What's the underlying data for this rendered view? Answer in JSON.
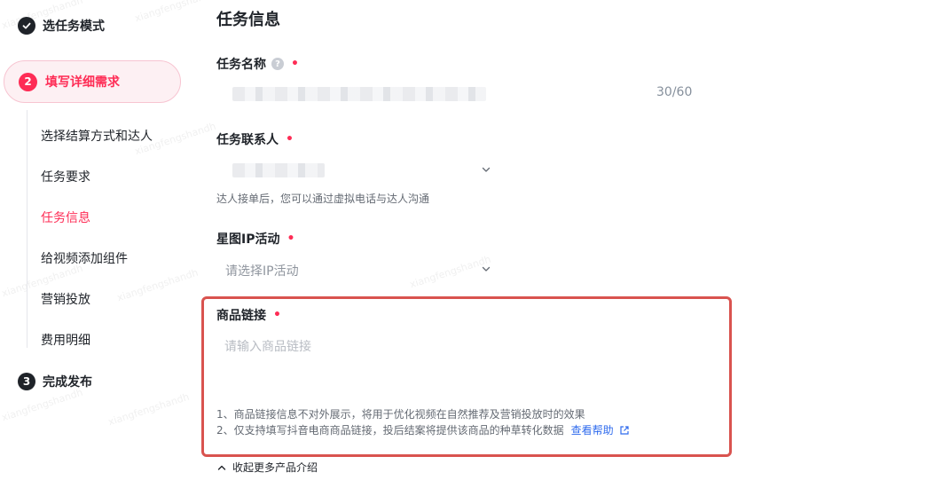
{
  "steps": [
    {
      "number": "",
      "label": "选任务模式",
      "state": "done",
      "icon": "check-icon"
    },
    {
      "number": "2",
      "label": "填写详细需求",
      "state": "active"
    },
    {
      "number": "3",
      "label": "完成发布",
      "state": "pending"
    }
  ],
  "substeps": [
    {
      "label": "选择结算方式和达人"
    },
    {
      "label": "任务要求"
    },
    {
      "label": "任务信息",
      "active": true
    },
    {
      "label": "给视频添加组件"
    },
    {
      "label": "营销投放"
    },
    {
      "label": "费用明细"
    }
  ],
  "form": {
    "section_title": "任务信息",
    "required_mark": "•",
    "task_name": {
      "label": "任务名称",
      "help_icon": "question-icon",
      "counter": "30/60"
    },
    "contact": {
      "label": "任务联系人",
      "hint": "达人接单后，您可以通过虚拟电话与达人沟通"
    },
    "ip_activity": {
      "label": "星图IP活动",
      "placeholder": "请选择IP活动"
    },
    "product_link": {
      "label": "商品链接",
      "placeholder": "请输入商品链接",
      "note1": "1、商品链接信息不对外展示，将用于优化视频在自然推荐及营销投放时的效果",
      "note2": "2、仅支持填写抖音电商商品链接，投后结案将提供该商品的种草转化数据",
      "help_link": "查看帮助"
    },
    "collapse_label": "收起更多产品介绍"
  },
  "colors": {
    "accent": "#fe2c55",
    "link": "#2f6bed",
    "highlight_border": "#d9534f"
  }
}
